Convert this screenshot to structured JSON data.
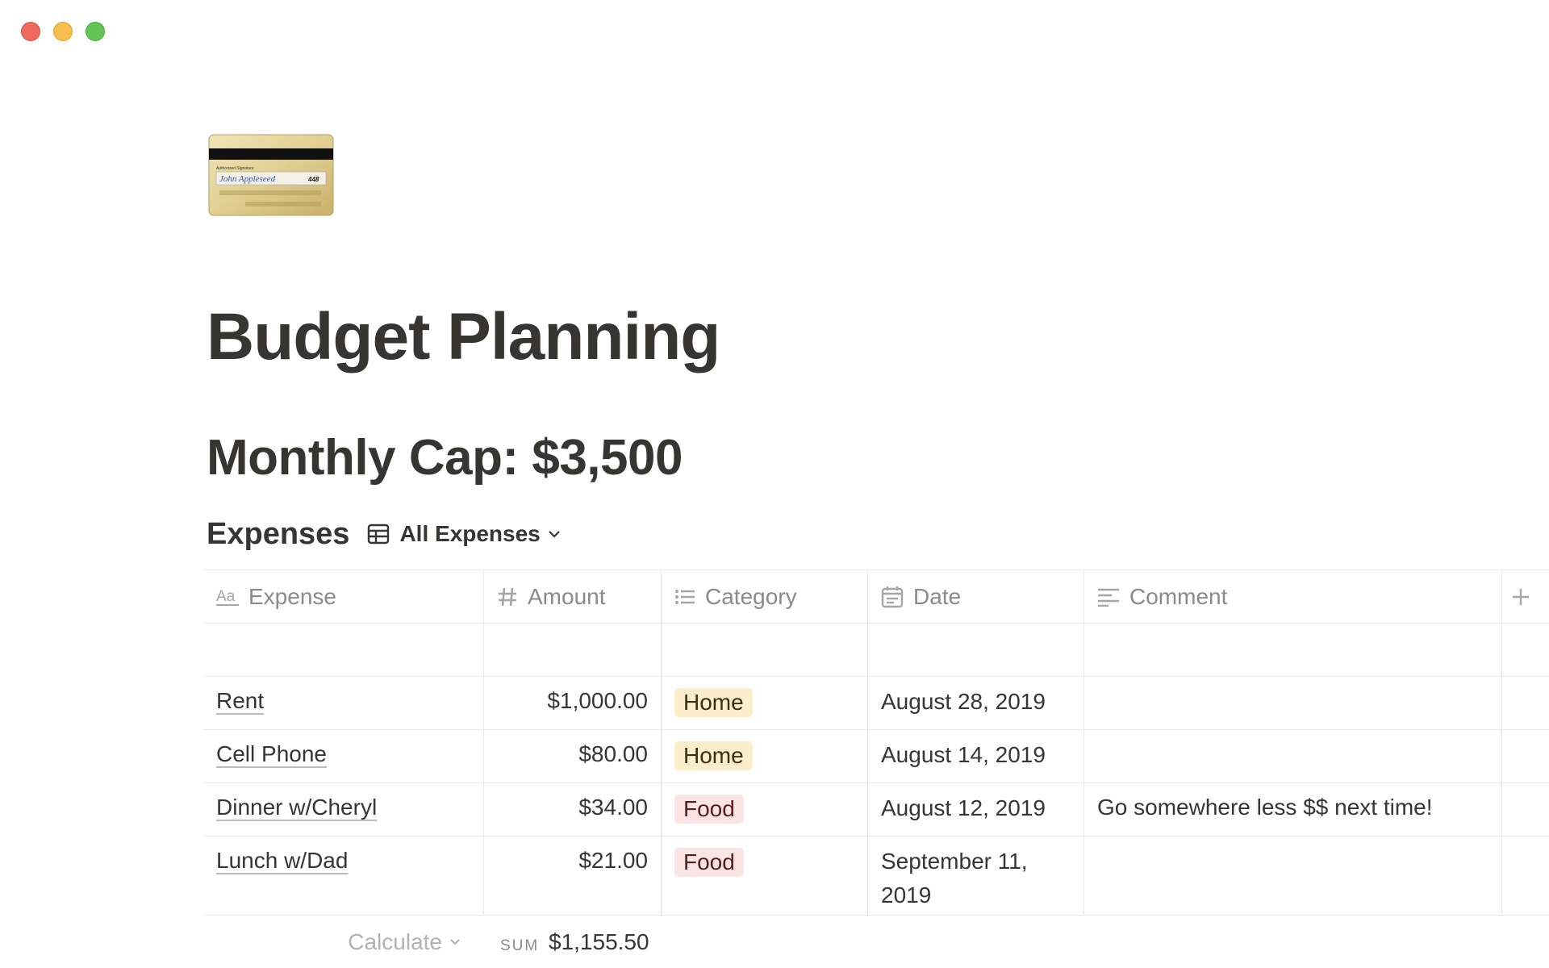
{
  "window": {
    "controls": [
      "close",
      "minimize",
      "zoom"
    ]
  },
  "page": {
    "icon": "credit-card-icon",
    "card_signature_text": "Authorized Signature",
    "card_signature_name": "John Appleseed",
    "card_cvv": "448",
    "title": "Budget Planning",
    "heading": "Monthly Cap: $3,500"
  },
  "database": {
    "title": "Expenses",
    "view_label": "All Expenses",
    "view_icon": "table-icon",
    "columns": [
      {
        "label": "Expense",
        "icon": "text-property-icon"
      },
      {
        "label": "Amount",
        "icon": "number-property-icon"
      },
      {
        "label": "Category",
        "icon": "select-property-icon"
      },
      {
        "label": "Date",
        "icon": "date-property-icon"
      },
      {
        "label": "Comment",
        "icon": "text-block-property-icon"
      }
    ],
    "add_column_icon": "plus-icon",
    "rows": [
      {
        "expense": "Rent",
        "amount": "$1,000.00",
        "category": "Home",
        "date": "August 28, 2019",
        "comment": ""
      },
      {
        "expense": "Cell Phone",
        "amount": "$80.00",
        "category": "Home",
        "date": "August 14, 2019",
        "comment": ""
      },
      {
        "expense": "Dinner w/Cheryl",
        "amount": "$34.00",
        "category": "Food",
        "date": "August 12, 2019",
        "comment": "Go somewhere less $$ next time!"
      },
      {
        "expense": "Lunch w/Dad",
        "amount": "$21.00",
        "category": "Food",
        "date": "September 11, 2019",
        "comment": ""
      }
    ],
    "footer": {
      "calculate_label": "Calculate",
      "sum_label": "SUM",
      "sum_value": "$1,155.50"
    }
  },
  "colors": {
    "text": "#37352f",
    "muted": "#8c8a84",
    "divider": "#e9e9e7",
    "tag_home_bg": "#fbeecb",
    "tag_food_bg": "#fbe4e4"
  }
}
